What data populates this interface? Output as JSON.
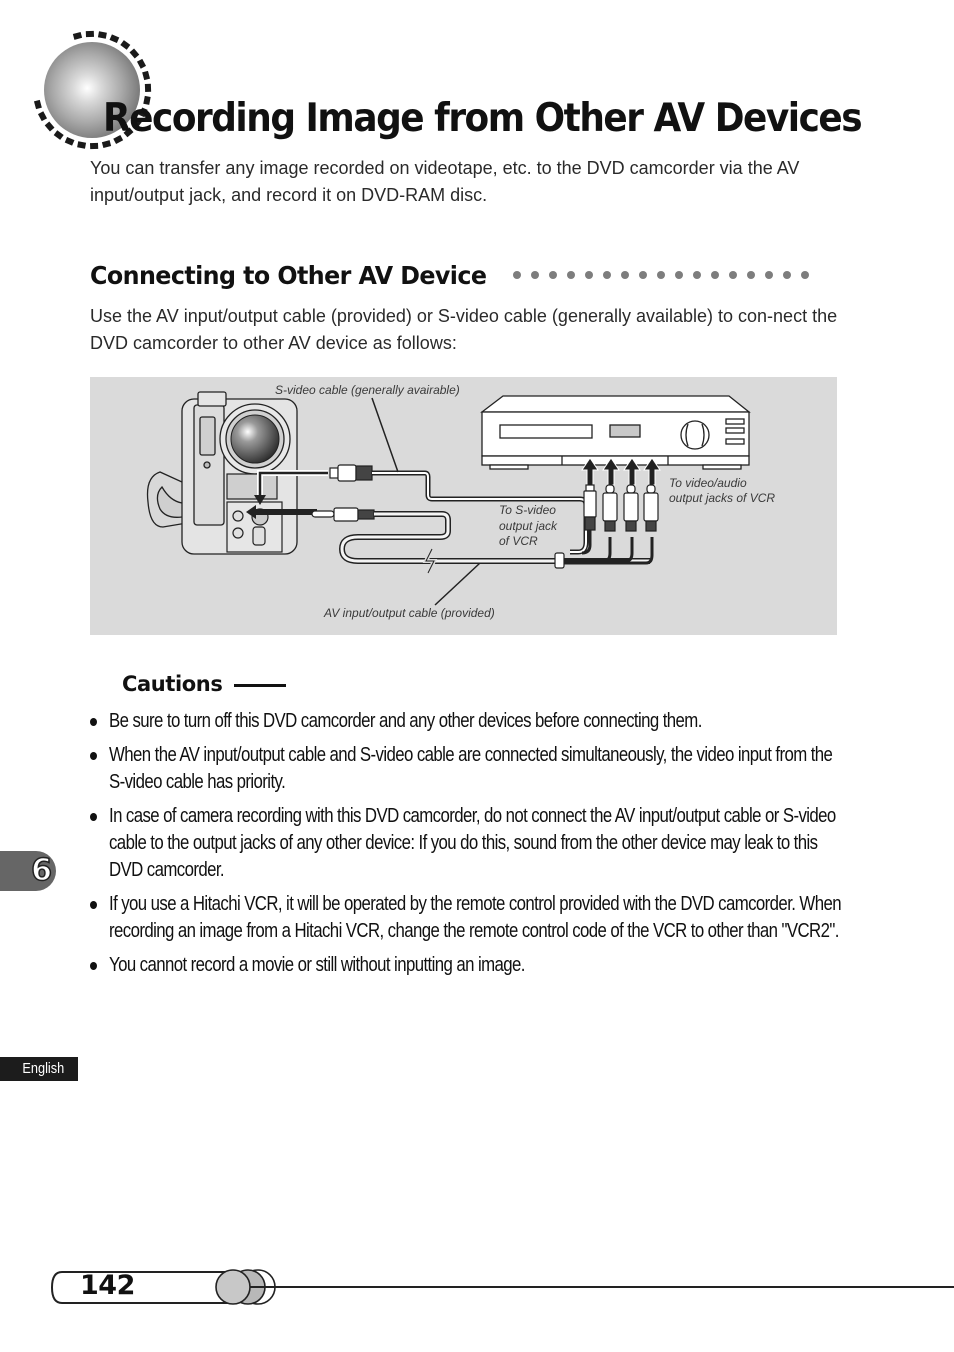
{
  "page": {
    "title": "Recording Image from Other AV Devices",
    "intro": "You can transfer any image recorded on videotape, etc. to the DVD camcorder via the AV input/output jack, and record it on DVD-RAM disc."
  },
  "section": {
    "title": "Connecting to Other AV Device",
    "body": "Use the AV input/output cable (provided) or S-video cable (generally available) to con-nect the DVD camcorder to other AV device as follows:",
    "figure": {
      "labels": {
        "s_video_cable": "S-video cable (generally avairable)",
        "av_cable": "AV input/output cable (provided)",
        "to_s_video_line1": "To S-video",
        "to_s_video_line2": "output jack",
        "to_s_video_line3": "of VCR",
        "to_video_audio_line1": "To video/audio",
        "to_video_audio_line2": "output jacks of VCR"
      }
    }
  },
  "cautions": {
    "title": "Cautions",
    "items": [
      "Be sure to turn off this DVD camcorder and any other devices before connecting them.",
      "When the AV input/output cable and S-video cable are connected simultaneously, the video input from the S-video cable has priority.",
      "In case of camera recording with this DVD camcorder, do not connect the AV input/output cable or S-video cable to the output jacks of any other device: If you do this, sound from the other device may leak to this DVD camcorder.",
      "If you use a Hitachi VCR, it will be operated by the remote control provided with the DVD camcorder. When recording an image from a Hitachi VCR, change the remote control code of the VCR to other than \"VCR2\".",
      "You cannot record a movie or still without inputting an image."
    ]
  },
  "chapter": {
    "number": "6"
  },
  "language": "English",
  "footer": {
    "page_number": "142"
  }
}
